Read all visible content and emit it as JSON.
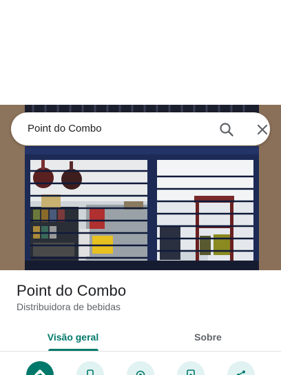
{
  "search": {
    "query": "Point do Combo"
  },
  "place": {
    "name": "Point do Combo",
    "category": "Distribuidora de bebidas"
  },
  "tabs": [
    {
      "label": "Visão geral",
      "active": true
    },
    {
      "label": "Sobre",
      "active": false
    }
  ],
  "actions": [
    {
      "icon": "directions-icon",
      "primary": true
    },
    {
      "icon": "phone-icon",
      "primary": false
    },
    {
      "icon": "location-icon",
      "primary": false
    },
    {
      "icon": "save-icon",
      "primary": false
    },
    {
      "icon": "share-icon",
      "primary": false
    }
  ],
  "colors": {
    "accent": "#00796b",
    "action_bg": "#e0f2f1",
    "frame": "#1c2a55"
  }
}
